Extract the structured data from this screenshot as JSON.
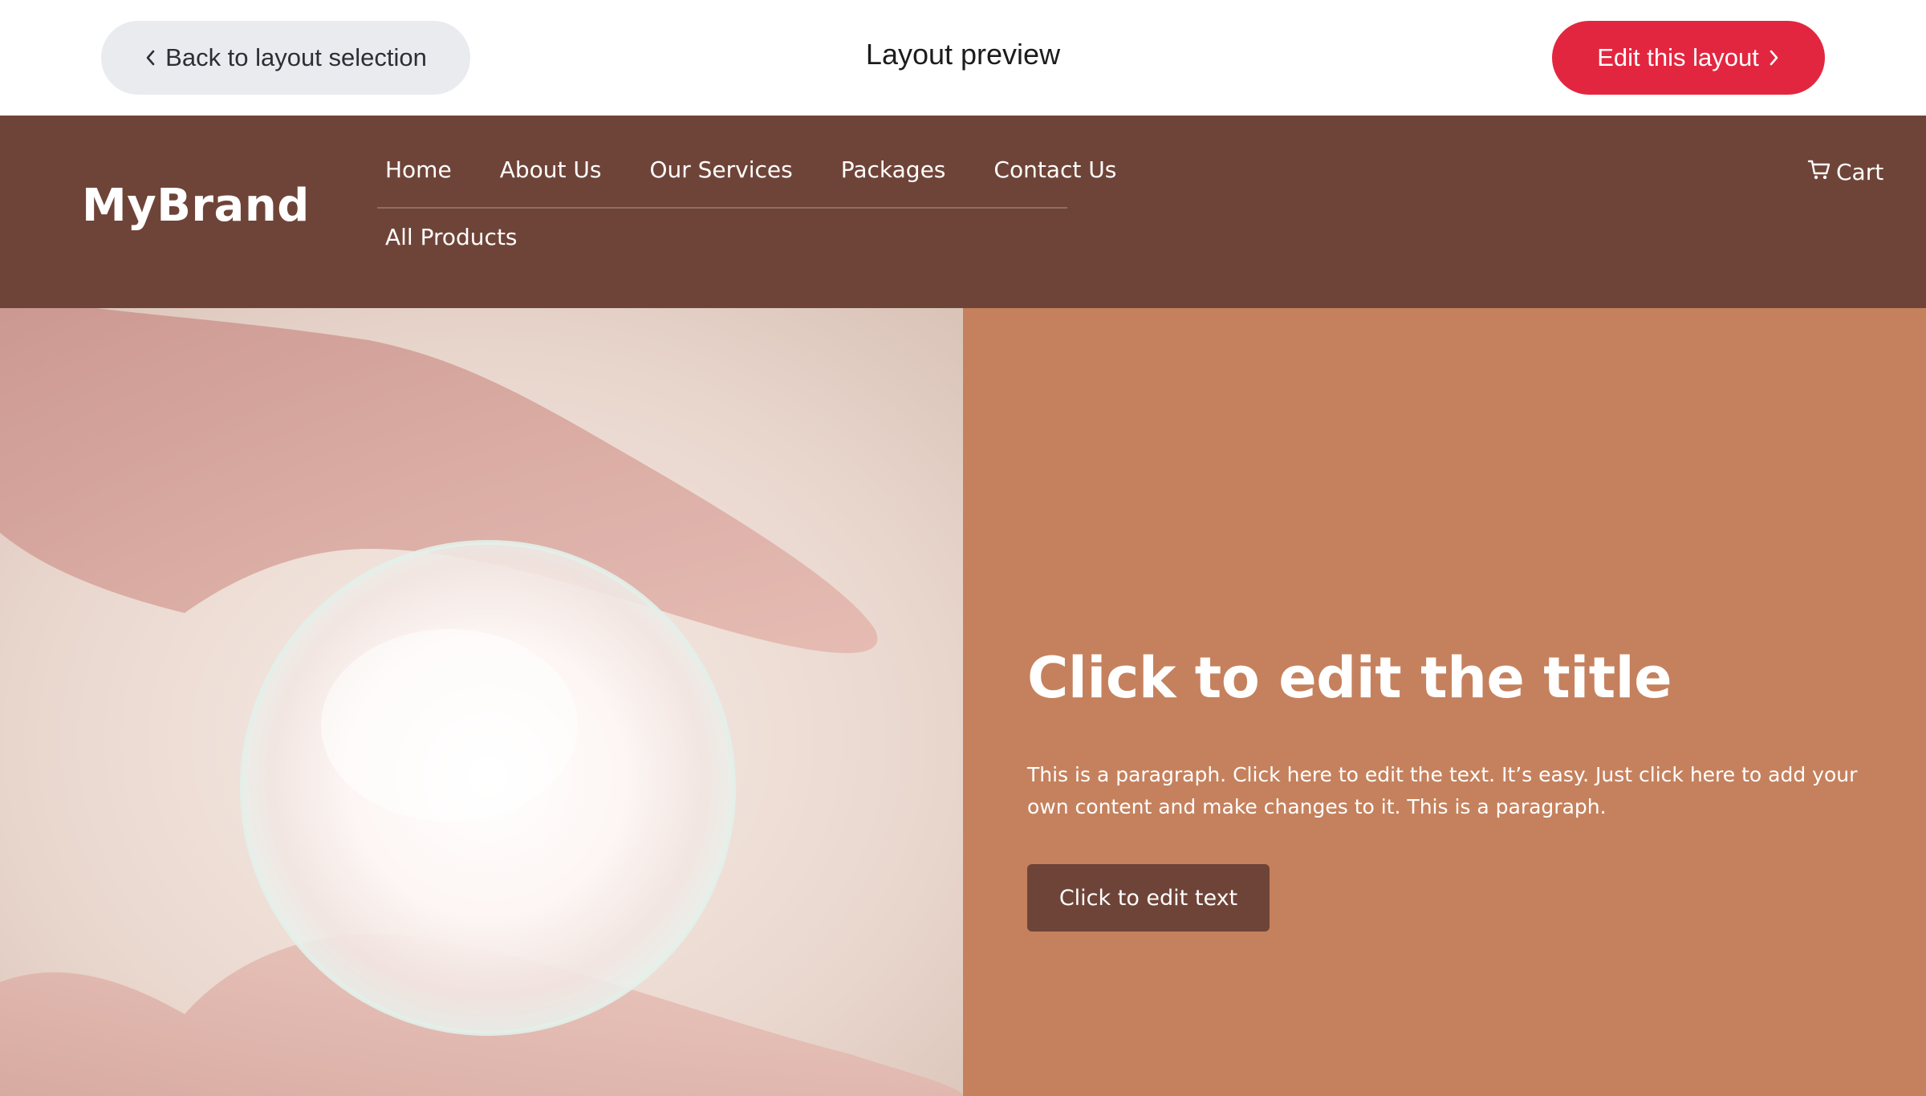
{
  "preview_bar": {
    "back_label": "Back to layout selection",
    "title": "Layout preview",
    "edit_label": "Edit this layout"
  },
  "site": {
    "brand": "MyBrand",
    "nav": {
      "row1": [
        "Home",
        "About Us",
        "Our Services",
        "Packages",
        "Contact Us"
      ],
      "row2": [
        "All Products"
      ]
    },
    "cart_label": "Cart"
  },
  "hero": {
    "image_icon": "crystal-ball-hands-photo",
    "title": "Click to edit the title",
    "paragraph": "This is a paragraph. Click here to edit the text. It’s easy. Just click here to add your own content and make changes to it. This is a paragraph.",
    "button_label": "Click to edit text"
  },
  "colors": {
    "header_bg": "#6f4438",
    "hero_bg": "#c5815d",
    "edit_button": "#e32640",
    "back_button": "#e9ebef",
    "hero_button": "#6f4438"
  }
}
